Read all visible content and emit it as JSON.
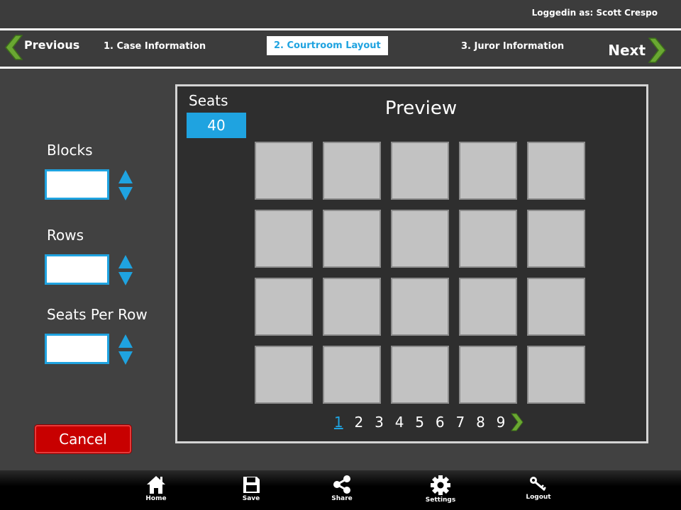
{
  "header": {
    "logged_in_text": "Loggedin as: Scott Crespo"
  },
  "wizard": {
    "previous_label": "Previous",
    "next_label": "Next",
    "steps": [
      {
        "label": "1. Case Information"
      },
      {
        "label": "2. Courtroom Layout"
      },
      {
        "label": "3. Juror Information"
      }
    ],
    "active_step": 2,
    "accent_color": "#1fa3e0",
    "arrow_color": "#6aa832"
  },
  "config": {
    "blocks_label": "Blocks",
    "blocks_value": "",
    "rows_label": "Rows",
    "rows_value": "",
    "seats_per_row_label": "Seats Per Row",
    "seats_per_row_value": "",
    "cancel_label": "Cancel"
  },
  "preview": {
    "seats_label": "Seats",
    "seats_count": "40",
    "title": "Preview",
    "grid_columns": 5,
    "grid_rows": 4,
    "pages": [
      "1",
      "2",
      "3",
      "4",
      "5",
      "6",
      "7",
      "8",
      "9"
    ],
    "current_page": "1"
  },
  "toolbar": {
    "items": [
      {
        "label": "Home",
        "icon": "home-icon"
      },
      {
        "label": "Save",
        "icon": "save-icon"
      },
      {
        "label": "Share",
        "icon": "share-icon"
      },
      {
        "label": "Settings",
        "icon": "gear-icon"
      },
      {
        "label": "Logout",
        "icon": "logout-icon"
      }
    ]
  },
  "colors": {
    "background": "#414141",
    "panel": "#2e2e2e",
    "seat": "#c2c2c2",
    "cancel": "#c80000"
  }
}
